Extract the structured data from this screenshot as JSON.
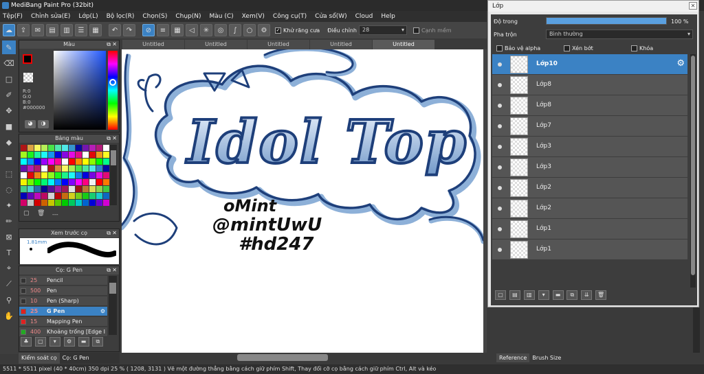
{
  "app": {
    "title": "MediBang Paint Pro (32bit)"
  },
  "menu": [
    "Tệp(F)",
    "Chỉnh sửa(E)",
    "Lớp(L)",
    "Bộ lọc(R)",
    "Chọn(S)",
    "Chụp(N)",
    "Màu (C)",
    "Xem(V)",
    "Công cụ(T)",
    "Cửa sổ(W)",
    "Cloud",
    "Help"
  ],
  "toolbar": {
    "antialias_label": "Khử răng cưa",
    "correction_label": "Điều chỉnh",
    "correction_value": "28",
    "edge_label": "Cạnh mềm"
  },
  "tabs": [
    "Untitled",
    "Untitled",
    "Untitled",
    "Untitled",
    "Untitled"
  ],
  "color_panel": {
    "title": "Màu",
    "r": "R:0",
    "g": "G:0",
    "b": "B:0",
    "hex": "#000000"
  },
  "palette_panel": {
    "title": "Bảng màu",
    "more": "---"
  },
  "preview_panel": {
    "title": "Xem trước cọ",
    "size": "1.81mm"
  },
  "brush_panel": {
    "title": "Cọ: G Pen",
    "brushes": [
      {
        "size": "25",
        "name": "Pencil",
        "color": "#333333"
      },
      {
        "size": "500",
        "name": "Pen",
        "color": "#333333"
      },
      {
        "size": "10",
        "name": "Pen (Sharp)",
        "color": "#333333"
      },
      {
        "size": "25",
        "name": "G Pen",
        "color": "#e02020"
      },
      {
        "size": "15",
        "name": "Mapping Pen",
        "color": "#e02020"
      },
      {
        "size": "400",
        "name": "Khoảng trống [Edge I",
        "color": "#22aa22"
      }
    ]
  },
  "bottom_tabs": [
    "Kiểm soát cọ",
    "Cọ: G Pen"
  ],
  "canvas_art": {
    "title_text": "Idol Top",
    "signature": [
      "oMint",
      "@mintUwU",
      "#hd247"
    ]
  },
  "layer_window": {
    "title": "Lớp",
    "opacity_label": "Độ trong",
    "opacity_value": "100 %",
    "opacity_fraction": 1.0,
    "blend_label": "Pha trộn",
    "blend_value": "Bình thường",
    "protect_alpha": "Bảo vệ alpha",
    "clipping": "Xén bớt",
    "lock": "Khóa",
    "layers": [
      "Lớp10",
      "Lớp8",
      "Lớp8",
      "Lớp7",
      "Lớp3",
      "Lớp3",
      "Lớp2",
      "Lớp2",
      "Lớp1",
      "Lớp1"
    ]
  },
  "right_tabs": [
    "Reference",
    "Brush Size"
  ],
  "status": {
    "text": "5511 * 5511 pixel  (40 * 40cm)  350 dpi  25 %  ( 1208, 3131 )  Vẽ một đường thẳng bằng cách giữ phím Shift, Thay đổi cỡ cọ bằng cách giữ phím Ctrl, Alt và kéo"
  },
  "colors": {
    "accent": "#3b82c4",
    "art_blue": "#1e3f7a",
    "art_light": "#8db0d8"
  }
}
